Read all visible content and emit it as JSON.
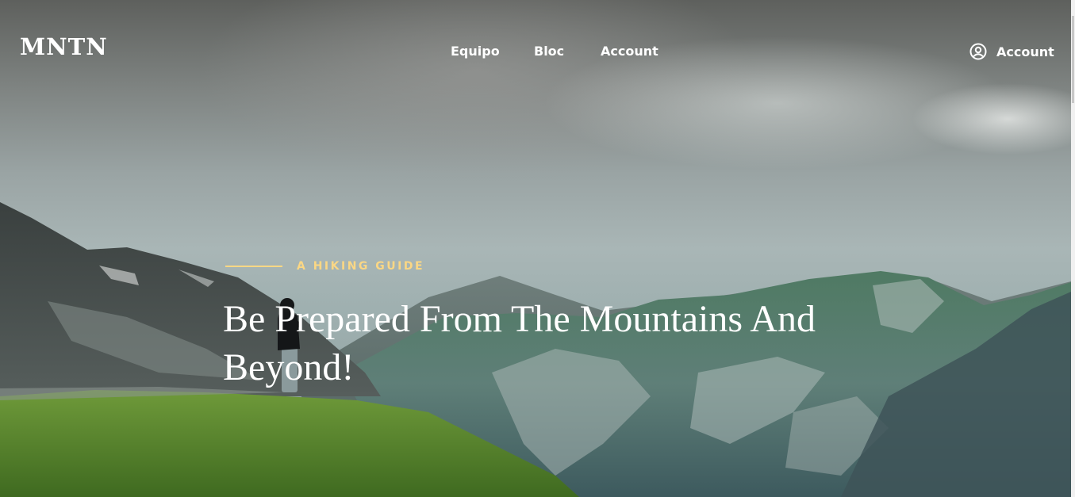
{
  "brand": {
    "logo": "MNTN"
  },
  "nav": {
    "items": [
      {
        "label": "Equipo"
      },
      {
        "label": "Bloc"
      },
      {
        "label": "Account"
      }
    ],
    "account_label": "Account",
    "account_icon": "user-circle-icon"
  },
  "hero": {
    "eyebrow": "A HIKING GUIDE",
    "headline": "Be Prepared From The Mountains And Beyond!",
    "accent_color": "#fbd784"
  }
}
